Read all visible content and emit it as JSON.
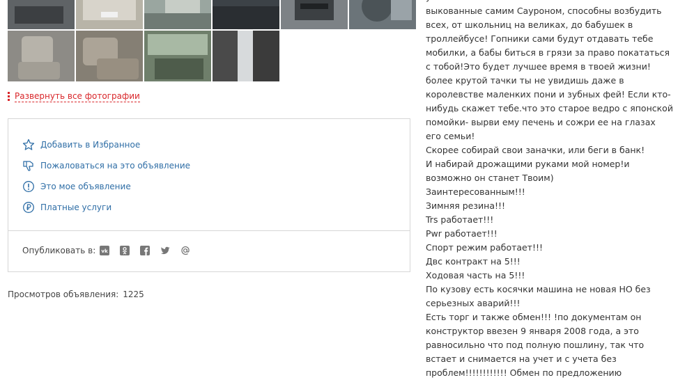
{
  "gallery": {
    "expand_label": "Развернуть все фотографии",
    "thumb_count": 10
  },
  "actions": [
    {
      "label": "Добавить в Избранное",
      "icon": "star-icon"
    },
    {
      "label": "Пожаловаться на это объявление",
      "icon": "thumbs-down-icon"
    },
    {
      "label": "Это мое объявление",
      "icon": "exclamation-circle-icon"
    },
    {
      "label": "Платные услуги",
      "icon": "ruble-circle-icon"
    }
  ],
  "share": {
    "label": "Опубликовать в:",
    "networks": [
      "vk-icon",
      "odnoklassniki-icon",
      "facebook-icon",
      "twitter-icon",
      "email-icon"
    ]
  },
  "views": {
    "label": "Просмотров объявления:",
    "count": "1225"
  },
  "description": {
    "lines": [
      "у ...",
      "выкованные самим Сауроном, способны возбудить",
      "всех, от школьниц на великах, до бабушек в",
      "троллейбусе! Гопники сами будут отдавать тебе",
      "мобилки, а бабы биться в грязи за право покататься",
      "с тобой!Это будет лучшее время в твоей жизни!",
      "более крутой тачки ты не увидишь даже в",
      "королевстве маленких пони и зубных фей! Если кто-",
      "нибудь скажет тебе.что это старое ведро с японской",
      "помойки- вырви ему печень и сожри ее на глазах",
      "его семьи!",
      "Скорее собирай свои заначки, или беги в банк!",
      "И набирай дрожащими руками мой номер!и",
      "возможно он станет Твоим)",
      "Заинтересованным!!!",
      "Зимняя резина!!!",
      "Trs работает!!!",
      "Pwr работает!!!",
      "Спорт режим работает!!!",
      "Двс контракт на 5!!!",
      "Ходовая часть на 5!!!",
      "По кузову есть косячки машина не новая НО без",
      "серьезных аварий!!!",
      "Есть торг и также обмен!!! !по документам он",
      "конструктор ввезен 9 января 2008 года, а это",
      "равносильно что под полную пошлину, так что",
      "встает и снимается на учет и с учета без",
      "проблем!!!!!!!!!!!! Обмен по предложению"
    ]
  },
  "colors": {
    "link": "#2f6ea6",
    "accent_red": "#d9262a",
    "border": "#d6d6d6"
  }
}
